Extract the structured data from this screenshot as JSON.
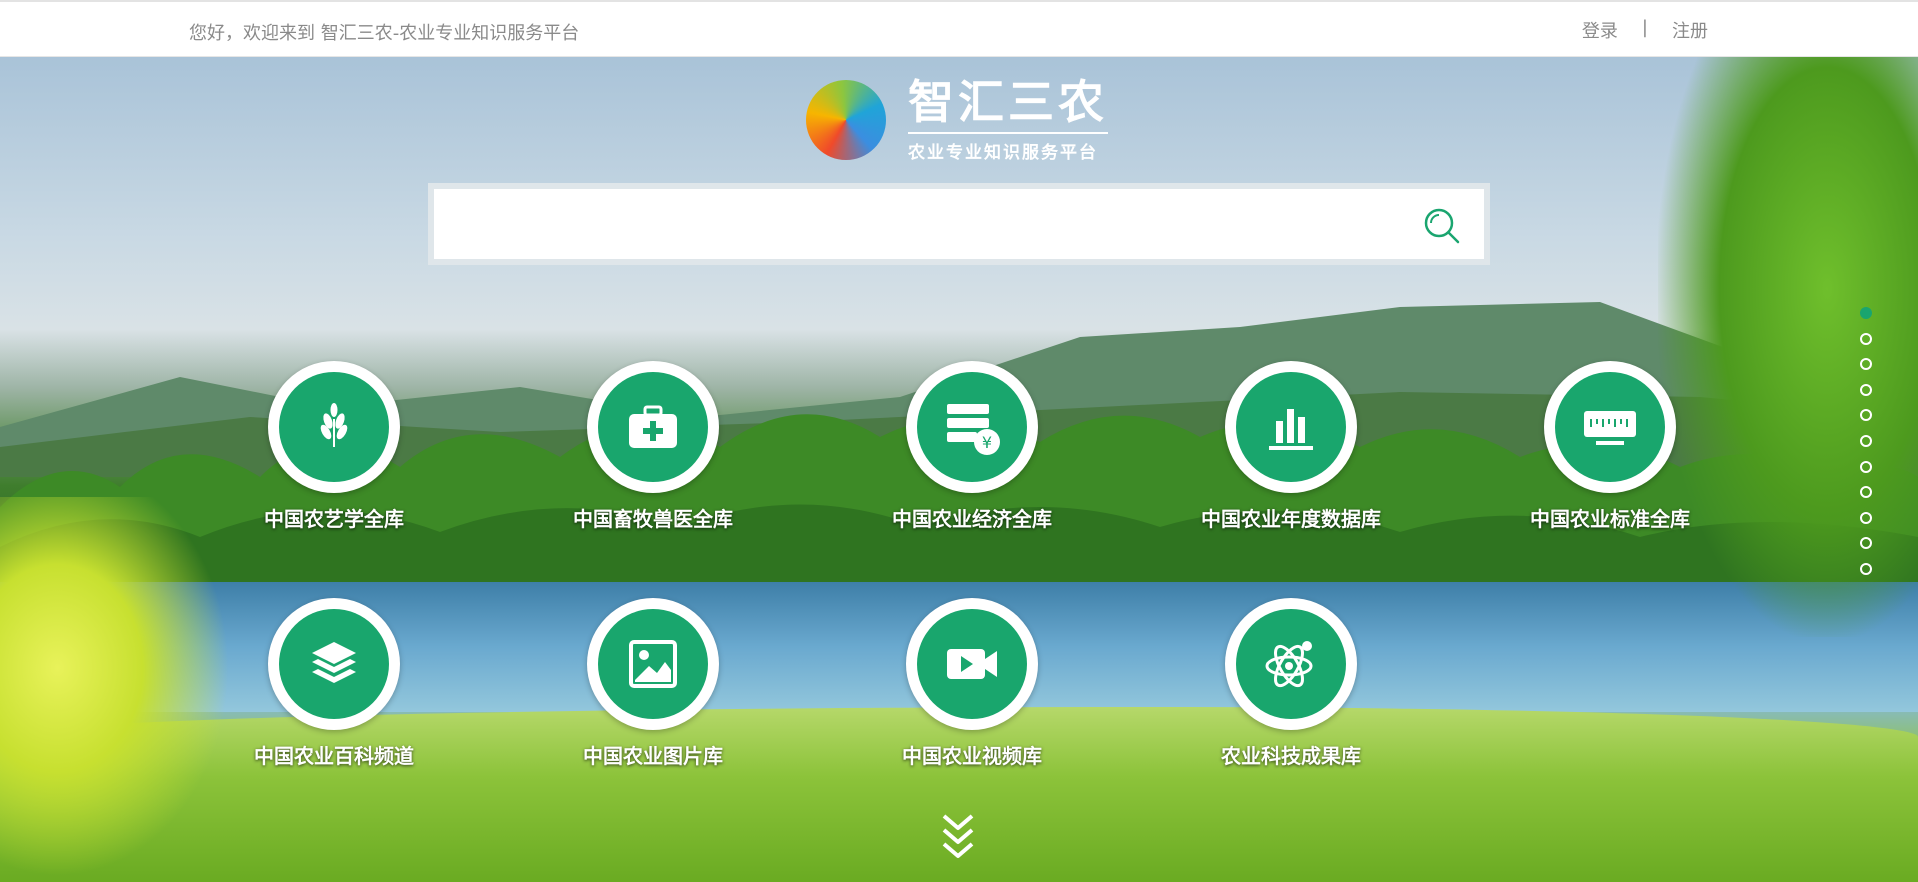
{
  "topbar": {
    "welcome": "您好，欢迎来到 智汇三农-农业专业知识服务平台",
    "login": "登录",
    "separator": "|",
    "register": "注册"
  },
  "logo": {
    "title": "智汇三农",
    "subtitle": "农业专业知识服务平台"
  },
  "search": {
    "placeholder": "",
    "value": "",
    "button_icon": "search-icon"
  },
  "databases": [
    {
      "label": "中国农艺学全库",
      "icon": "wheat-icon"
    },
    {
      "label": "中国畜牧兽医全库",
      "icon": "medical-kit-icon"
    },
    {
      "label": "中国农业经济全库",
      "icon": "finance-icon"
    },
    {
      "label": "中国农业年度数据库",
      "icon": "bar-chart-icon"
    },
    {
      "label": "中国农业标准全库",
      "icon": "ruler-icon"
    },
    {
      "label": "中国农业百科频道",
      "icon": "layers-icon"
    },
    {
      "label": "中国农业图片库",
      "icon": "image-icon"
    },
    {
      "label": "中国农业视频库",
      "icon": "video-icon"
    },
    {
      "label": "农业科技成果库",
      "icon": "atom-icon"
    }
  ],
  "pager": {
    "total": 11,
    "active": 1
  },
  "colors": {
    "accent": "#19a66d",
    "text_gray": "#8a8a8a"
  }
}
